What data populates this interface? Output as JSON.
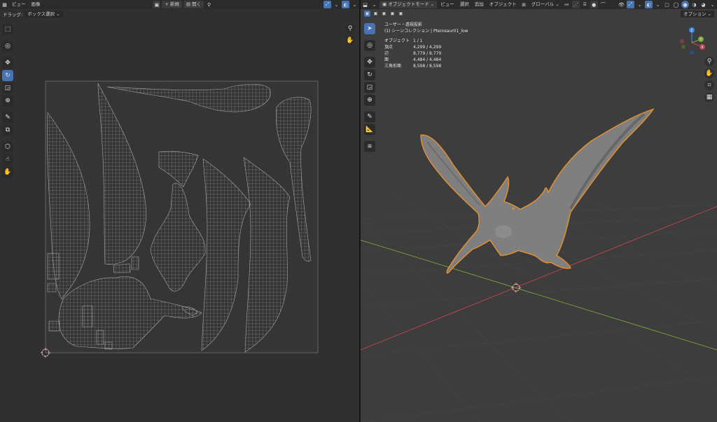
{
  "uv_editor": {
    "header": {
      "menu_view": "ビュー",
      "menu_image": "画像",
      "new_label": "新規",
      "open_label": "開く"
    },
    "subheader": {
      "drag_label": "ドラッグ:",
      "drag_mode": "ボックス選択"
    }
  },
  "viewport": {
    "header": {
      "mode": "オブジェクトモード",
      "menu_view": "ビュー",
      "menu_select": "選択",
      "menu_add": "追加",
      "menu_object": "オブジェクト",
      "transform_orientation": "グローバル",
      "options": "オプション"
    },
    "overlay": {
      "view_name": "ユーザー・透視投影",
      "collection": "(1) シーンコレクション | Pterosaur01_low",
      "stats": [
        {
          "label": "オブジェクト",
          "value": "1 / 1"
        },
        {
          "label": "頂点",
          "value": "4,299 / 4,299"
        },
        {
          "label": "辺",
          "value": "8,779 / 8,779"
        },
        {
          "label": "面",
          "value": "4,484 / 4,484"
        },
        {
          "label": "三角形面",
          "value": "8,598 / 8,598"
        }
      ]
    },
    "gizmo": {
      "x": "X",
      "y": "Y",
      "z": "Z"
    }
  },
  "colors": {
    "accent": "#4772b3",
    "selection_outline": "#e8912e",
    "axis_x": "#c0454f",
    "axis_y": "#7fa43a",
    "axis_z": "#3b82e0"
  }
}
